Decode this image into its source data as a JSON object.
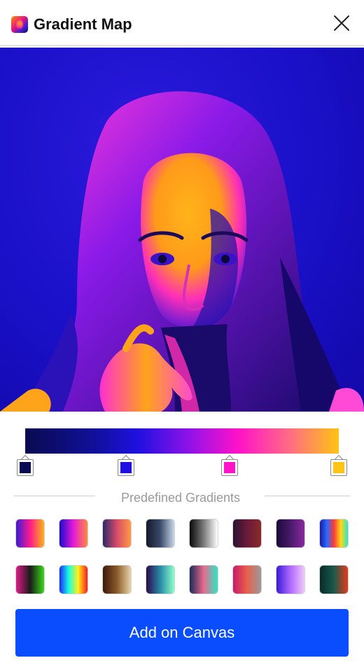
{
  "header": {
    "title": "Gradient Map",
    "close_icon": "close-icon",
    "app_icon": "app-logo-icon"
  },
  "gradient_editor": {
    "stops": [
      {
        "color": "#0a0a50",
        "position": 0.0
      },
      {
        "color": "#1f10e0",
        "position": 0.33
      },
      {
        "color": "#ff12c8",
        "position": 0.67
      },
      {
        "color": "#ffc414",
        "position": 1.0
      }
    ]
  },
  "presets": {
    "label": "Predefined Gradients",
    "items": [
      {
        "name": "purple-magenta-orange",
        "stops": [
          "#3a1ad8",
          "#ff1a8c",
          "#ffb414"
        ]
      },
      {
        "name": "blue-magenta-orange",
        "stops": [
          "#1a0acc",
          "#e51ad8",
          "#ff8a3a"
        ]
      },
      {
        "name": "navy-orange",
        "stops": [
          "#2a2a6a",
          "#d84a6a",
          "#ff9a44"
        ]
      },
      {
        "name": "dark-blue-gray",
        "stops": [
          "#141a2a",
          "#3a4a6a",
          "#c8d8e8"
        ]
      },
      {
        "name": "black-white",
        "stops": [
          "#0a0a0a",
          "#7a7a7a",
          "#ffffff"
        ]
      },
      {
        "name": "dark-maroon",
        "stops": [
          "#2a1430",
          "#6a1a3a",
          "#8a2a2a"
        ]
      },
      {
        "name": "dark-purple",
        "stops": [
          "#1a0a3a",
          "#4a1a6a",
          "#8a2aa0"
        ]
      },
      {
        "name": "rainbow-blue",
        "stops": [
          "#1a1aa8",
          "#2a6aff",
          "#ff3a3a",
          "#ffd814",
          "#2ae8c8"
        ]
      },
      {
        "name": "magenta-green",
        "stops": [
          "#e01a8a",
          "#1a1a1a",
          "#3ad81a"
        ]
      },
      {
        "name": "full-spectrum",
        "stops": [
          "#1a2aff",
          "#1affe0",
          "#fff01a",
          "#ff1a1a"
        ]
      },
      {
        "name": "sepia",
        "stops": [
          "#3a1a0a",
          "#8a5a2a",
          "#e8d4a8"
        ]
      },
      {
        "name": "indigo-mint",
        "stops": [
          "#2a0a4a",
          "#2a8aa8",
          "#8affc8"
        ]
      },
      {
        "name": "navy-coral-cyan",
        "stops": [
          "#1a2a5a",
          "#e86a8a",
          "#2ae8c8"
        ]
      },
      {
        "name": "rose-orange-gray",
        "stops": [
          "#c81a6a",
          "#e8604a",
          "#9a9a9a"
        ]
      },
      {
        "name": "violet-lilac",
        "stops": [
          "#3a1ad8",
          "#b06aff",
          "#f0c8f8"
        ]
      },
      {
        "name": "teal-red",
        "stops": [
          "#0a2a2a",
          "#1a5a4a",
          "#e83a1a"
        ]
      }
    ]
  },
  "actions": {
    "add_label": "Add on Canvas"
  },
  "colors": {
    "accent": "#0a4dff"
  }
}
